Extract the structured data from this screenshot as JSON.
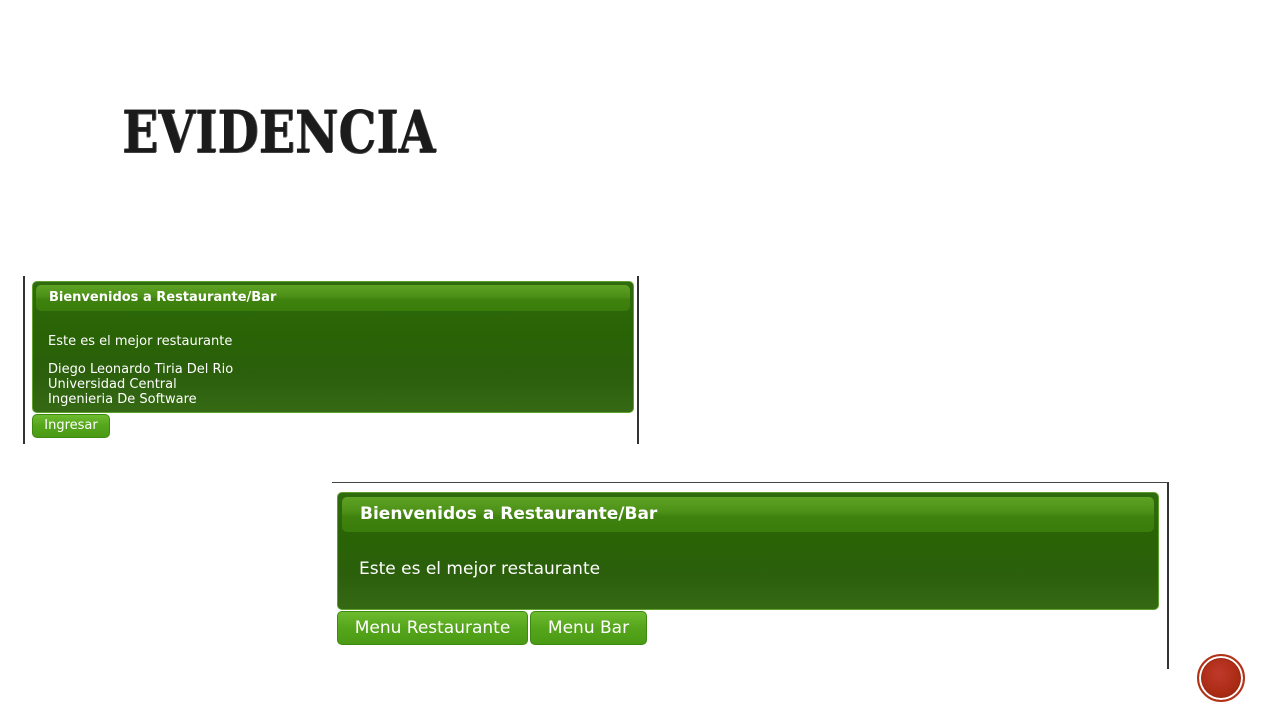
{
  "slide": {
    "title": "EVIDENCIA"
  },
  "screenshot_login": {
    "header": "Bienvenidos a Restaurante/Bar",
    "lines": [
      "Este es el mejor restaurante",
      "Diego Leonardo Tiria Del Rio",
      "Universidad Central",
      "Ingenieria De Software"
    ],
    "button_label": "Ingresar"
  },
  "screenshot_menu": {
    "header": "Bienvenidos a Restaurante/Bar",
    "lines": [
      "Este es el mejor restaurante"
    ],
    "buttons": [
      "Menu Restaurante",
      "Menu Bar"
    ]
  },
  "colors": {
    "panel_green": "#2a6306",
    "header_green": "#4b8f17",
    "button_green": "#55a51c",
    "nav_button_red": "#a82a12"
  },
  "icons": {
    "nav_button": "circle-nav-icon"
  }
}
